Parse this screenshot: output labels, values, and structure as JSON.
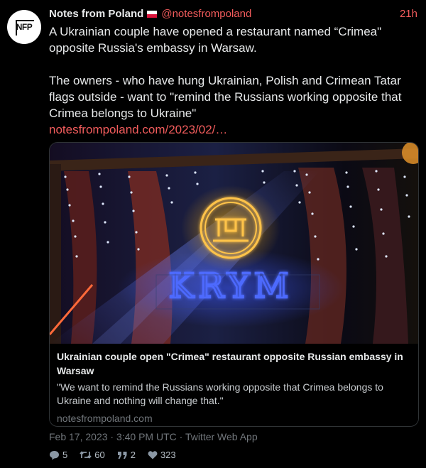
{
  "account": {
    "avatar_text": "NFP",
    "display_name": "Notes from Poland",
    "flag_icon": "poland-flag-icon",
    "handle": "@notesfrompoland",
    "time": "21h"
  },
  "tweet": {
    "paragraph1": "A Ukrainian couple have opened a restaurant named “Crimea\" opposite Russia's embassy in Warsaw.",
    "paragraph2": "The owners - who have hung Ukrainian, Polish and Crimean Tatar flags outside - want to \"remind the Russians working opposite that Crimea belongs to Ukraine\"",
    "link": "notesfrompoland.com/2023/02/…"
  },
  "card": {
    "image_sign_text": "KRYM",
    "title": "Ukrainian couple open \"Crimea\" restaurant opposite Russian embassy in Warsaw",
    "description": "\"We want to remind the Russians working opposite that Crimea belongs to Ukraine and nothing will change that.\"",
    "domain": "notesfrompoland.com"
  },
  "meta": {
    "timestamp": "Feb 17, 2023 · 3:40 PM UTC · Twitter Web App"
  },
  "actions": {
    "replies": "5",
    "retweets": "60",
    "quotes": "2",
    "likes": "323"
  },
  "colors": {
    "link": "#f25c5c",
    "neon_blue": "#3b57ff",
    "neon_gold": "#ffb300",
    "background": "#000000"
  }
}
